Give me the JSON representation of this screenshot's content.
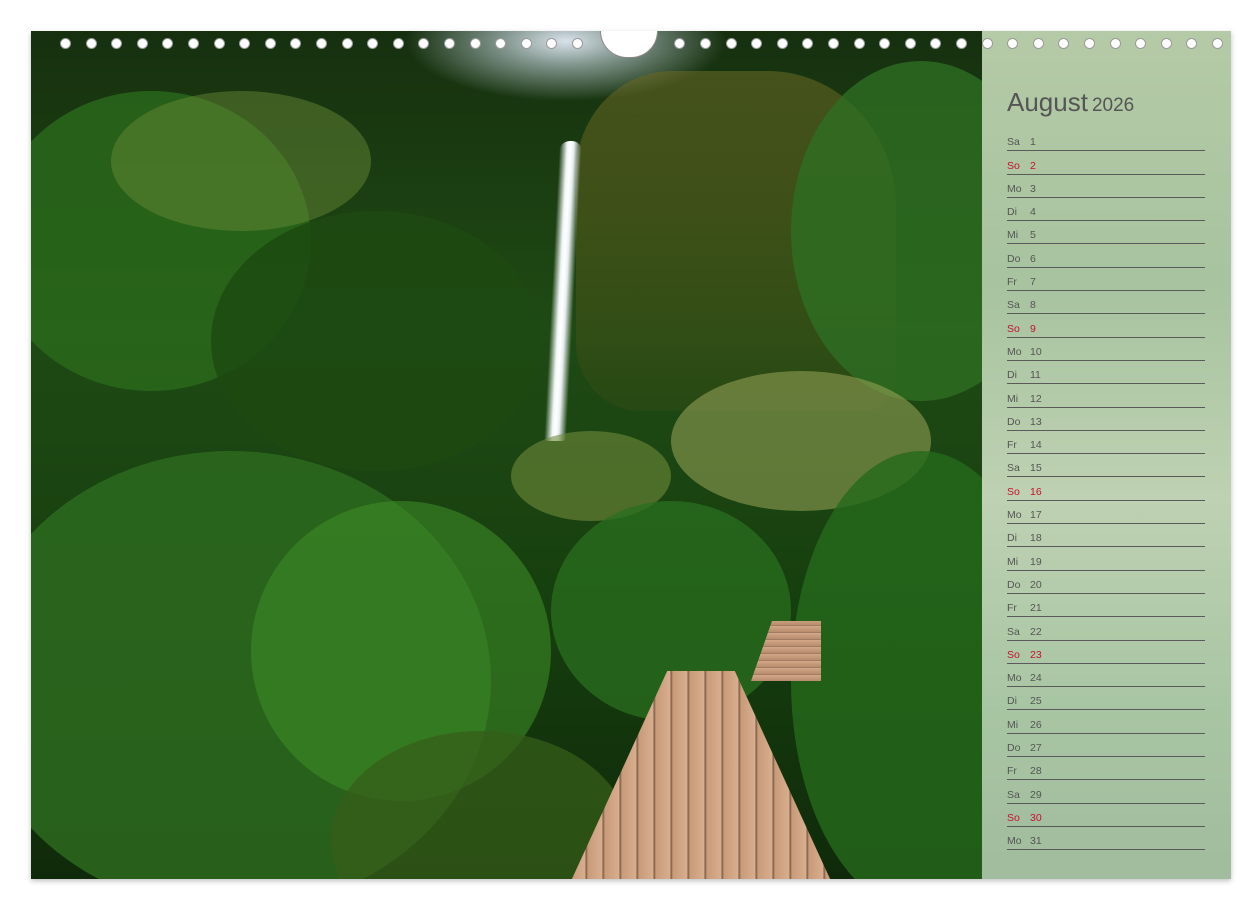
{
  "calendar": {
    "month": "August",
    "year": "2026",
    "days": [
      {
        "weekday": "Sa",
        "day": "1",
        "sunday": false
      },
      {
        "weekday": "So",
        "day": "2",
        "sunday": true
      },
      {
        "weekday": "Mo",
        "day": "3",
        "sunday": false
      },
      {
        "weekday": "Di",
        "day": "4",
        "sunday": false
      },
      {
        "weekday": "Mi",
        "day": "5",
        "sunday": false
      },
      {
        "weekday": "Do",
        "day": "6",
        "sunday": false
      },
      {
        "weekday": "Fr",
        "day": "7",
        "sunday": false
      },
      {
        "weekday": "Sa",
        "day": "8",
        "sunday": false
      },
      {
        "weekday": "So",
        "day": "9",
        "sunday": true
      },
      {
        "weekday": "Mo",
        "day": "10",
        "sunday": false
      },
      {
        "weekday": "Di",
        "day": "11",
        "sunday": false
      },
      {
        "weekday": "Mi",
        "day": "12",
        "sunday": false
      },
      {
        "weekday": "Do",
        "day": "13",
        "sunday": false
      },
      {
        "weekday": "Fr",
        "day": "14",
        "sunday": false
      },
      {
        "weekday": "Sa",
        "day": "15",
        "sunday": false
      },
      {
        "weekday": "So",
        "day": "16",
        "sunday": true
      },
      {
        "weekday": "Mo",
        "day": "17",
        "sunday": false
      },
      {
        "weekday": "Di",
        "day": "18",
        "sunday": false
      },
      {
        "weekday": "Mi",
        "day": "19",
        "sunday": false
      },
      {
        "weekday": "Do",
        "day": "20",
        "sunday": false
      },
      {
        "weekday": "Fr",
        "day": "21",
        "sunday": false
      },
      {
        "weekday": "Sa",
        "day": "22",
        "sunday": false
      },
      {
        "weekday": "So",
        "day": "23",
        "sunday": true
      },
      {
        "weekday": "Mo",
        "day": "24",
        "sunday": false
      },
      {
        "weekday": "Di",
        "day": "25",
        "sunday": false
      },
      {
        "weekday": "Mi",
        "day": "26",
        "sunday": false
      },
      {
        "weekday": "Do",
        "day": "27",
        "sunday": false
      },
      {
        "weekday": "Fr",
        "day": "28",
        "sunday": false
      },
      {
        "weekday": "Sa",
        "day": "29",
        "sunday": false
      },
      {
        "weekday": "So",
        "day": "30",
        "sunday": true
      },
      {
        "weekday": "Mo",
        "day": "31",
        "sunday": false
      }
    ]
  },
  "colors": {
    "text": "#555555",
    "sunday": "#c8102e",
    "rule": "#5a5a5a"
  },
  "photo": {
    "subject": "jungle-waterfall-boardwalk-photo"
  }
}
